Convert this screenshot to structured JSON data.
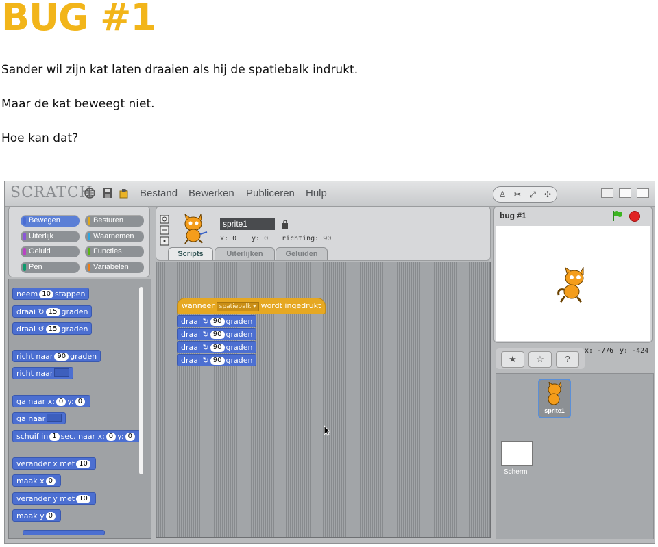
{
  "doc": {
    "title": "BUG #1",
    "line1": "Sander wil zijn kat laten draaien als hij de spatiebalk indrukt.",
    "line2": "Maar de kat beweegt niet.",
    "line3": "Hoe kan dat?"
  },
  "menu": {
    "logo": "SCRATCH",
    "items": [
      "Bestand",
      "Bewerken",
      "Publiceren",
      "Hulp"
    ]
  },
  "categories": {
    "left": [
      "Bewegen",
      "Uiterlijk",
      "Geluid",
      "Pen"
    ],
    "right": [
      "Besturen",
      "Waarnemen",
      "Functies",
      "Variabelen"
    ],
    "selected": "Bewegen",
    "colors": {
      "Bewegen": "#4a6cd4",
      "Uiterlijk": "#8a55d7",
      "Geluid": "#bb42c3",
      "Pen": "#0e9a6c",
      "Besturen": "#e1a91a",
      "Waarnemen": "#2ca5e2",
      "Functies": "#5cb712",
      "Variabelen": "#ee7d16"
    }
  },
  "palette": {
    "b1": {
      "pre": "neem",
      "v": "10",
      "post": "stappen"
    },
    "b2": {
      "pre": "draai",
      "v": "15",
      "post": "graden"
    },
    "b3": {
      "pre": "draai",
      "v": "15",
      "post": "graden"
    },
    "b4": {
      "pre": "richt naar",
      "v": "90",
      "post": "graden"
    },
    "b5": {
      "pre": "richt naar"
    },
    "b6": {
      "pre": "ga naar x:",
      "v": "0",
      "mid": "y:",
      "v2": "0"
    },
    "b7": {
      "pre": "ga naar"
    },
    "b8": {
      "pre": "schuif in",
      "v": "1",
      "mid": "sec. naar x:",
      "v2": "0",
      "mid2": "y:",
      "v3": "0"
    },
    "b9": {
      "pre": "verander x met",
      "v": "10"
    },
    "b10": {
      "pre": "maak x",
      "v": "0"
    },
    "b11": {
      "pre": "verander y met",
      "v": "10"
    },
    "b12": {
      "pre": "maak y",
      "v": "0"
    }
  },
  "sprite": {
    "name": "sprite1",
    "x_label": "x:",
    "x": "0",
    "y_label": "y:",
    "y": "0",
    "dir_label": "richting:",
    "dir": "90"
  },
  "tabs": [
    "Scripts",
    "Uiterlijken",
    "Geluiden"
  ],
  "script": {
    "hat_pre": "wanneer",
    "hat_key": "spatiebalk",
    "hat_post": "wordt ingedrukt",
    "turns": [
      {
        "pre": "draai",
        "v": "90",
        "post": "graden"
      },
      {
        "pre": "draai",
        "v": "90",
        "post": "graden"
      },
      {
        "pre": "draai",
        "v": "90",
        "post": "graden"
      },
      {
        "pre": "draai",
        "v": "90",
        "post": "graden"
      }
    ]
  },
  "stage": {
    "title": "bug #1",
    "x_label": "x:",
    "x": "-776",
    "y_label": "y:",
    "y": "-424"
  },
  "sprites_pane": {
    "sprite_label": "sprite1",
    "stage_label": "Scherm"
  }
}
